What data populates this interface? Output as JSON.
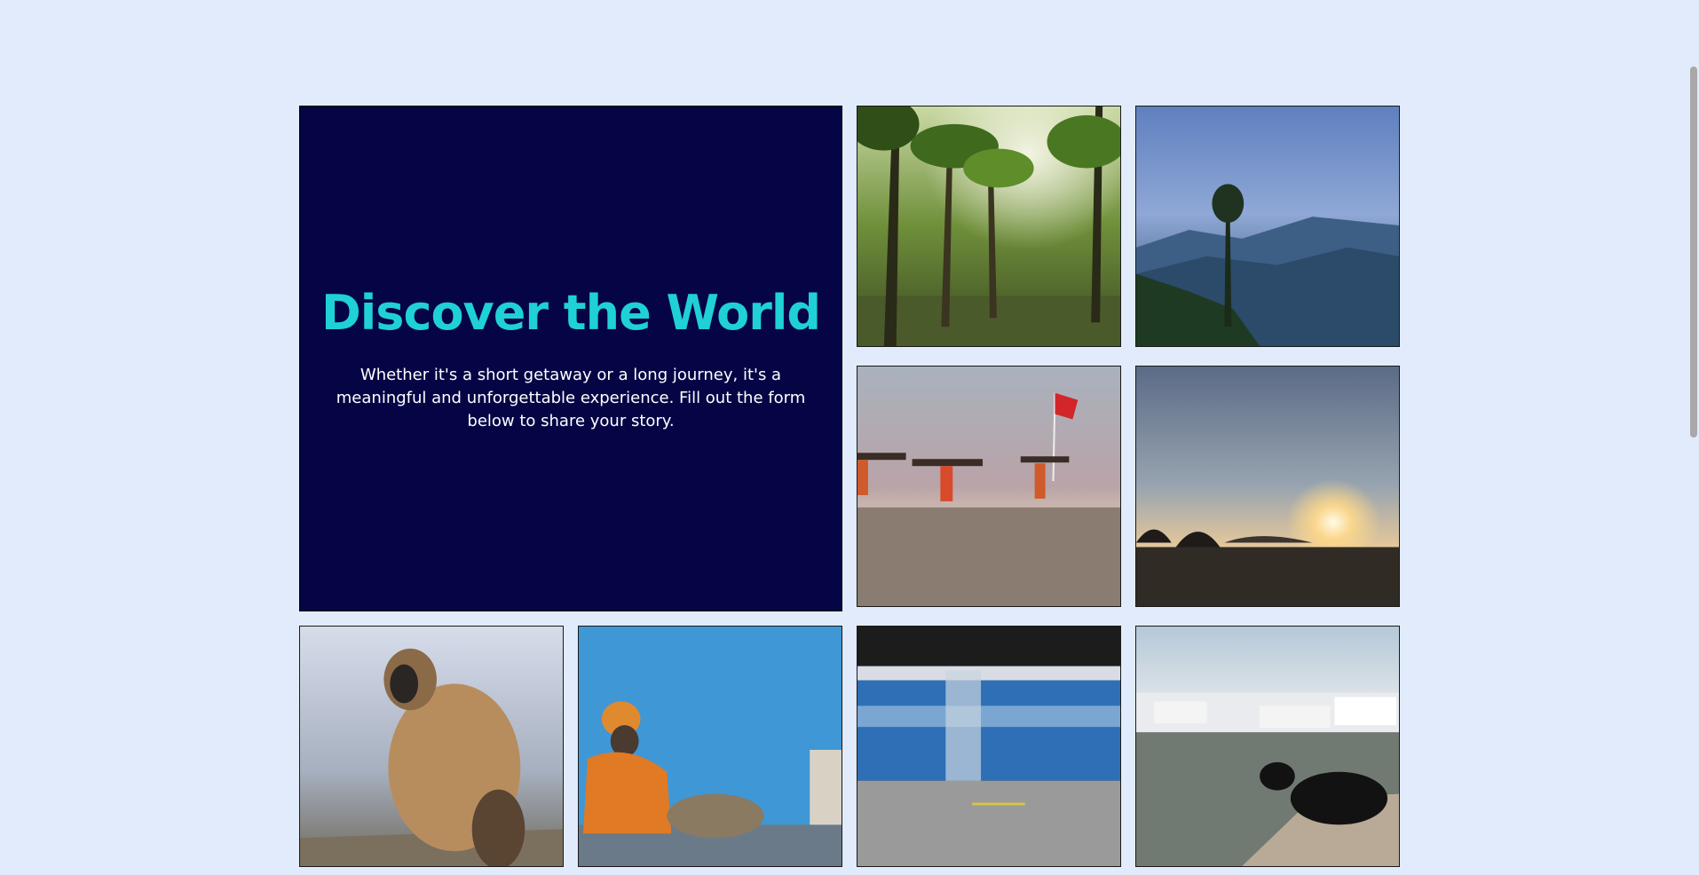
{
  "hero": {
    "title": "Discover the World",
    "description": "Whether it's a short getaway or a long journey, it's a meaningful and unforgettable experience. Fill out the form below to share your story."
  },
  "colors": {
    "page_background": "#e1ebfc",
    "hero_background": "#050546",
    "hero_title": "#1fd1d6",
    "hero_text": "#ffffff"
  },
  "gallery": [
    {
      "name": "palm-grove-photo"
    },
    {
      "name": "misty-mountains-photo"
    },
    {
      "name": "beach-women-carrying-wood-photo"
    },
    {
      "name": "sunset-over-shore-photo"
    },
    {
      "name": "langur-monkey-photo"
    },
    {
      "name": "sadhu-blue-wall-photo"
    },
    {
      "name": "blurred-train-photo"
    },
    {
      "name": "lake-cow-photo"
    }
  ]
}
